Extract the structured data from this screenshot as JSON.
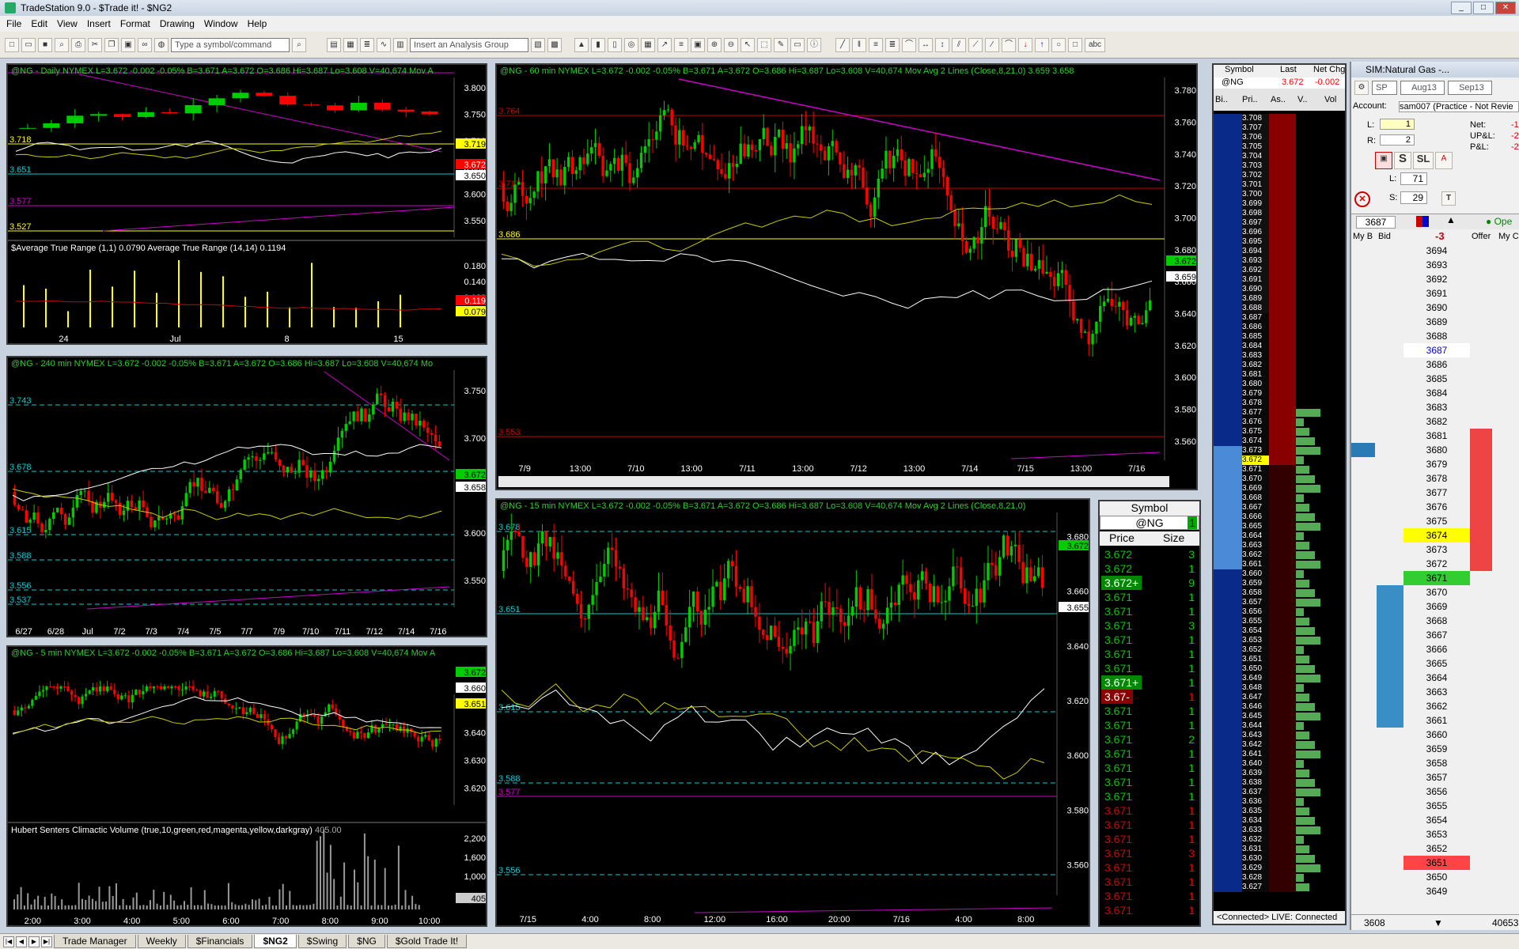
{
  "window": {
    "title": "TradeStation 9.0 - $Trade it! - $NG2",
    "min": "_",
    "max": "□",
    "close": "✕"
  },
  "menu": [
    "File",
    "Edit",
    "View",
    "Insert",
    "Format",
    "Drawing",
    "Window",
    "Help"
  ],
  "toolbar": {
    "symbol_placeholder": "Type a symbol/command",
    "analysis_placeholder": "Insert an Analysis Group",
    "text_tool": "abc"
  },
  "charts": {
    "daily": {
      "header": "@NG - Daily  NYMEX  L=3.672 -0.002 -0.05%  B=3.671  A=3.672  O=3.686  Hi=3.687  Lo=3.608  V=40,674  Mov A",
      "ticks": [
        "3.800",
        "3.750",
        "3.700",
        "3.650",
        "3.600",
        "3.550"
      ],
      "tags": [
        "3.719",
        "3.672",
        "3.650"
      ],
      "levels": [
        "3.718",
        "3.651",
        "3.577",
        "3.527"
      ],
      "sub_header": "$Average True Range (1,1)  0.0790  Average True Range (14,14)  0.1194",
      "sub_ticks": [
        "0.180",
        "0.140",
        "0.100"
      ],
      "sub_tags": [
        "0.119",
        "0.079"
      ],
      "xlabels": [
        "24",
        "Jul",
        "8",
        "15"
      ]
    },
    "h240": {
      "header": "@NG - 240 min  NYMEX  L=3.672 -0.002 -0.05%  B=3.671  A=3.672  O=3.686  Hi=3.687  Lo=3.608  V=40,674  Mo",
      "ticks": [
        "3.750",
        "3.700",
        "3.650",
        "3.600",
        "3.550"
      ],
      "tags": [
        "3.672",
        "3.658"
      ],
      "levels": [
        "3.743",
        "3.678",
        "3.615",
        "3.588",
        "3.556",
        "3.537"
      ],
      "xlabels": [
        "6/27",
        "6/28",
        "Jul",
        "7/2",
        "7/3",
        "7/4",
        "7/5",
        "7/7",
        "7/9",
        "7/10",
        "7/11",
        "7/12",
        "7/14",
        "7/16"
      ]
    },
    "m5": {
      "header": "@NG - 5 min  NYMEX  L=3.672 -0.002 -0.05%  B=3.671  A=3.672  O=3.686  Hi=3.687  Lo=3.608  V=40,674  Mov A",
      "ticks": [
        "3.650",
        "3.640",
        "3.630",
        "3.620"
      ],
      "tags": [
        "3.672",
        "3.660",
        "3.651"
      ],
      "sub_header": "Hubert Senters Climactic Volume (true,10,green,red,magenta,yellow,darkgray)",
      "sub_value": "405.00",
      "sub_ticks": [
        "2,200",
        "1,600",
        "1,000"
      ],
      "sub_tag": "405",
      "xlabels": [
        "2:00",
        "3:00",
        "4:00",
        "5:00",
        "6:00",
        "7:00",
        "8:00",
        "9:00",
        "10:00"
      ]
    },
    "m60": {
      "header": "@NG - 60 min  NYMEX  L=3.672 -0.002 -0.05%  B=3.671  A=3.672  O=3.686  Hi=3.687  Lo=3.608  V=40,674  Mov Avg 2 Lines (Close,8,21,0)  3.659  3.658",
      "ticks": [
        "3.780",
        "3.760",
        "3.740",
        "3.720",
        "3.700",
        "3.680",
        "3.660",
        "3.640",
        "3.620",
        "3.600",
        "3.580",
        "3.560"
      ],
      "tags": [
        "3.672",
        "3.659"
      ],
      "levels": [
        "3.764",
        "3.717",
        "3.686",
        "3.553"
      ],
      "xlabels": [
        "7/9",
        "13:00",
        "7/10",
        "13:00",
        "7/11",
        "13:00",
        "7/12",
        "13:00",
        "7/14",
        "7/15",
        "13:00",
        "7/16"
      ]
    },
    "m15": {
      "header": "@NG - 15 min  NYMEX  L=3.672 -0.002 -0.05%  B=3.671  A=3.672  O=3.686  Hi=3.687  Lo=3.608  V=40,674  Mov Avg 2 Lines (Close,8,21,0)",
      "ticks": [
        "3.680",
        "3.660",
        "3.640",
        "3.620",
        "3.600",
        "3.580",
        "3.560"
      ],
      "tags": [
        "3.672",
        "3.655"
      ],
      "levels": [
        "3.678",
        "3.651",
        "3.615",
        "3.588",
        "3.577",
        "3.556"
      ],
      "xlabels": [
        "7/15",
        "4:00",
        "8:00",
        "12:00",
        "16:00",
        "20:00",
        "7/16",
        "4:00",
        "8:00"
      ]
    }
  },
  "timesales": {
    "symbol_label": "Symbol",
    "symbol": "@NG",
    "symbol_count": "1",
    "col_price": "Price",
    "col_size": "Size",
    "rows": [
      [
        "3.672",
        "3"
      ],
      [
        "3.672",
        "1"
      ],
      [
        "3.672+",
        "9"
      ],
      [
        "3.671",
        "1"
      ],
      [
        "3.671",
        "1"
      ],
      [
        "3.671",
        "3"
      ],
      [
        "3.671",
        "1"
      ],
      [
        "3.671",
        "1"
      ],
      [
        "3.671",
        "1"
      ],
      [
        "3.671+",
        "1"
      ],
      [
        "3.67-",
        "1"
      ],
      [
        "3.671",
        "1"
      ],
      [
        "3.671",
        "1"
      ],
      [
        "3.671",
        "2"
      ],
      [
        "3.671",
        "1"
      ],
      [
        "3.671",
        "1"
      ],
      [
        "3.671",
        "1"
      ],
      [
        "3.671",
        "1"
      ],
      [
        "3.671",
        "1"
      ],
      [
        "3.671",
        "1"
      ],
      [
        "3.671",
        "1"
      ],
      [
        "3.671",
        "3"
      ],
      [
        "3.671",
        "1"
      ],
      [
        "3.671",
        "1"
      ],
      [
        "3.671",
        "1"
      ],
      [
        "3.671",
        "1"
      ]
    ]
  },
  "ladder": {
    "col1": "Symbol",
    "col2": "Last",
    "col3": "Net Chg",
    "sym": "@NG",
    "last": "3.672",
    "chg": "-0.002",
    "sub": [
      "Bi..",
      "Pri..",
      "As..",
      "V..",
      "Vol"
    ],
    "status": "<Connected> LIVE: Connected"
  },
  "dom": {
    "title": "SIM:Natural Gas -...",
    "exch": "SP",
    "m1": "Aug13",
    "m2": "Sep13",
    "account_label": "Account:",
    "account": "sam007 (Practice - Not Revie",
    "net_label": "Net:",
    "net": "-1",
    "upl_label": "UP&L:",
    "upl": "-2",
    "pl_label": "P&L:",
    "pl": "-2",
    "l_label": "L:",
    "l_val": "1",
    "r_label": "R:",
    "r_val": "2",
    "l2_label": "L:",
    "l2_val": "71",
    "s_label": "S:",
    "s_val": "29",
    "price_box": "3687",
    "pos": "-3",
    "open": "Ope",
    "col_mybid": "My B",
    "col_bid": "Bid",
    "col_offer": "Offer",
    "col_myoff": "My C",
    "foot_price": "3608",
    "foot_right": "40653"
  },
  "tabs": [
    "Trade Manager",
    "Weekly",
    "$Financials",
    "$NG2",
    "$Swing",
    "$NG",
    "$Gold Trade It!"
  ],
  "active_tab": "$NG2"
}
